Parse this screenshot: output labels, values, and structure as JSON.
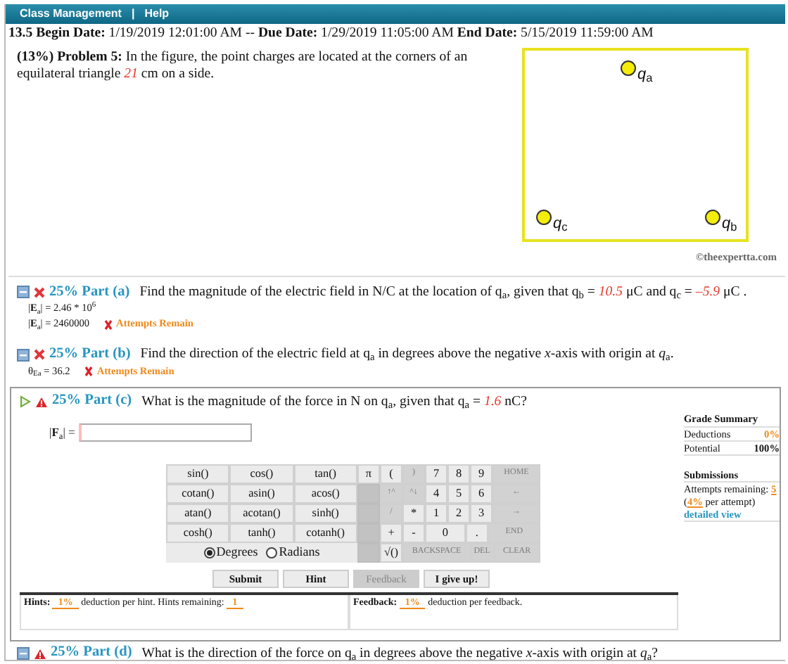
{
  "nav": {
    "items": [
      {
        "label": "Class Management"
      },
      {
        "label": "Help"
      }
    ],
    "separator": "|"
  },
  "dates": "**13.5 Begin Date:** 1/19/2019 12:01:00 AM -- **Due Date:** 1/29/2019 11:05:00 AM **End Date:** 5/15/2019 11:59:00 AM",
  "problem": {
    "text": [
      {
        "text": "**(13%)  Problem 5:**   In the figure, the point charges are located at the corners of an equilateral triangle "
      },
      {
        "value": "21"
      },
      {
        "text": " cm on a side."
      }
    ],
    "figure": {
      "charges": [
        {
          "label": "*q*$_{a}$"
        },
        {
          "label": "*q*$_{c}$"
        },
        {
          "label": "*q*$_{b}$"
        }
      ]
    },
    "copyright": "©theexpertta.com"
  },
  "parts": [
    {
      "kind": "answered",
      "current": false,
      "answered_wrong": true,
      "title": "25% Part (a)",
      "question": [
        {
          "text": "Find the magnitude of the electric field in N/C at the location of q$_{a}$, given that q$_{b}$ = "
        },
        {
          "value": "10.5"
        },
        {
          "text": " μC and q$_{c}$ = "
        },
        {
          "value": "–5.9"
        },
        {
          "text": " μC ."
        }
      ],
      "answers": [
        {
          "text": "|**E**$_{a}$| = 2.46 * 10$^{6}$"
        },
        {
          "text": "|**E**$_{a}$| = 2460000",
          "result": "Attempts Remain"
        }
      ]
    },
    {
      "kind": "answered",
      "current": false,
      "answered_wrong": true,
      "title": "25% Part (b)",
      "question": [
        {
          "text": "Find the direction of the electric field at q$_{a}$ in degrees above the negative *x*-axis with origin at *q*$_{a}$."
        }
      ],
      "answers": [
        {
          "text": "θ$_{Ea}$ = 36.2",
          "result": "Attempts Remain"
        }
      ]
    },
    {
      "kind": "active",
      "current": true,
      "answered_wrong": false,
      "title": "25% Part (c)",
      "question": [
        {
          "text": "What is the magnitude of the force in N on q$_{a}$, given that q$_{a}$ = "
        },
        {
          "value": "1.6"
        },
        {
          "text": " nC?"
        }
      ],
      "input_label": "|**F**$_{a}$| =",
      "function_keys": [
        [
          "sin()",
          "cos()",
          "tan()"
        ],
        [
          "cotan()",
          "asin()",
          "acos()"
        ],
        [
          "atan()",
          "acotan()",
          "sinh()"
        ],
        [
          "cosh()",
          "tanh()",
          "cotanh()"
        ]
      ],
      "angle_modes": [
        {
          "label": "Degrees",
          "selected": true
        },
        {
          "label": "Radians",
          "selected": false
        }
      ],
      "keys": [
        [
          {
            "kind": "key",
            "label": "π",
            "disabled": false
          },
          {
            "kind": "key",
            "label": "(",
            "disabled": false
          },
          {
            "kind": "key",
            "label": ")",
            "disabled": true
          },
          {
            "kind": "key",
            "label": "7",
            "disabled": false
          },
          {
            "kind": "key",
            "label": "8",
            "disabled": false
          },
          {
            "kind": "key",
            "label": "9",
            "disabled": false
          },
          {
            "kind": "wide",
            "label": "HOME",
            "disabled": true
          }
        ],
        [
          {
            "kind": "blank"
          },
          {
            "kind": "key",
            "label": "↑^",
            "disabled": true
          },
          {
            "kind": "key",
            "label": "^↓",
            "disabled": true
          },
          {
            "kind": "key",
            "label": "4",
            "disabled": false
          },
          {
            "kind": "key",
            "label": "5",
            "disabled": false
          },
          {
            "kind": "key",
            "label": "6",
            "disabled": false
          },
          {
            "kind": "wide",
            "label": "←",
            "disabled": true
          }
        ],
        [
          {
            "kind": "blank"
          },
          {
            "kind": "key",
            "label": "/",
            "disabled": true
          },
          {
            "kind": "key",
            "label": "*",
            "disabled": false
          },
          {
            "kind": "key",
            "label": "1",
            "disabled": false
          },
          {
            "kind": "key",
            "label": "2",
            "disabled": false
          },
          {
            "kind": "key",
            "label": "3",
            "disabled": false
          },
          {
            "kind": "wide",
            "label": "→",
            "disabled": true
          }
        ],
        [
          {
            "kind": "blank"
          },
          {
            "kind": "key",
            "label": "+",
            "disabled": false
          },
          {
            "kind": "key",
            "label": "-",
            "disabled": false
          },
          {
            "kind": "wide",
            "label": "0",
            "disabled": false
          },
          {
            "kind": "key",
            "label": ".",
            "disabled": false
          },
          {
            "kind": "wide",
            "label": "END",
            "disabled": true
          }
        ],
        [
          {
            "kind": "blank"
          },
          {
            "kind": "key",
            "label": "√()",
            "disabled": false
          },
          {
            "kind": "wide",
            "label": "BACKSPACE",
            "disabled": true
          },
          {
            "kind": "key",
            "label": "DEL",
            "disabled": true
          },
          {
            "kind": "wide",
            "label": "CLEAR",
            "disabled": true
          }
        ]
      ],
      "buttons": [
        {
          "label": "Submit",
          "disabled": false
        },
        {
          "label": "Hint",
          "disabled": false
        },
        {
          "label": "Feedback",
          "disabled": true
        },
        {
          "label": "I give up!",
          "disabled": false
        }
      ],
      "hints": {
        "label": "Hints:",
        "value": "1%",
        "text": "deduction per hint. Hints remaining:",
        "remaining": "1"
      },
      "feedback": {
        "label": "Feedback:",
        "value": "1%",
        "text": "deduction per feedback."
      },
      "grade_summary": {
        "title": "Grade Summary",
        "rows": [
          {
            "label": "Deductions",
            "value": "0%",
            "kind": "deduction"
          },
          {
            "label": "Potential",
            "value": "100%",
            "kind": "potential"
          }
        ]
      },
      "submissions": {
        "title": "Submissions",
        "attempts_label": "Attempts remaining:",
        "attempts": "5",
        "cost_before": "(",
        "cost": "4%",
        "cost_after": "per attempt)",
        "link": "detailed view"
      }
    },
    {
      "kind": "collapsed",
      "current": false,
      "answered_wrong": false,
      "title": "25% Part (d)",
      "question": [
        {
          "text": "What is the direction of the force on q$_{a}$ in degrees above the negative *x*-axis with origin at *q*$_{a}$?"
        }
      ]
    }
  ]
}
